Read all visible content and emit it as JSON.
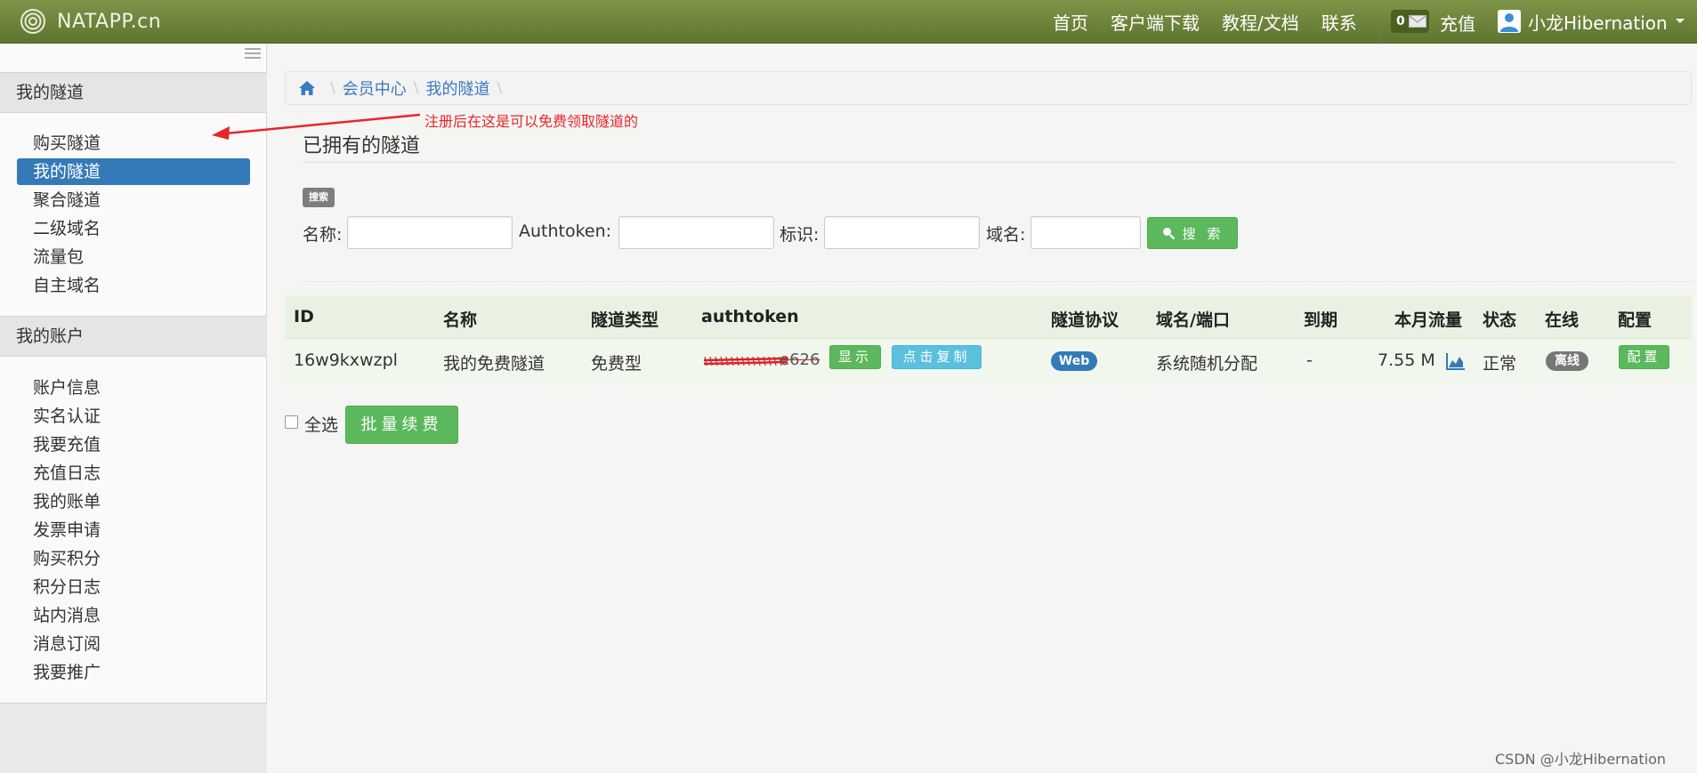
{
  "navbar": {
    "brand": "NATAPP.cn",
    "links": [
      "首页",
      "客户端下载",
      "教程/文档",
      "联系"
    ],
    "message_count": "0",
    "recharge": "充值",
    "user_name": "小龙Hibernation"
  },
  "sidebar": {
    "section1_title": "我的隧道",
    "section1_items": [
      "购买隧道",
      "我的隧道",
      "聚合隧道",
      "二级域名",
      "流量包",
      "自主域名"
    ],
    "section2_title": "我的账户",
    "section2_items": [
      "账户信息",
      "实名认证",
      "我要充值",
      "充值日志",
      "我的账单",
      "发票申请",
      "购买积分",
      "积分日志",
      "站内消息",
      "消息订阅",
      "我要推广"
    ]
  },
  "breadcrumb": [
    "会员中心",
    "我的隧道"
  ],
  "annotation": "注册后在这是可以免费领取隧道的",
  "page_title": "已拥有的隧道",
  "search": {
    "tag": "搜索",
    "name_label": "名称:",
    "authtoken_label": "Authtoken:",
    "tag_label": "标识:",
    "domain_label": "域名:",
    "button": "搜 索"
  },
  "table": {
    "headers": [
      "ID",
      "名称",
      "隧道类型",
      "authtoken",
      "隧道协议",
      "域名/端口",
      "到期",
      "本月流量",
      "状态",
      "在线",
      "配置"
    ],
    "rows": [
      {
        "id": "16w9kxwzpl",
        "name": "我的免费隧道",
        "type": "免费型",
        "authtoken_suffix": "e626",
        "show_button": "显示",
        "copy_button": "点击复制",
        "protocol": "Web",
        "domain": "系统随机分配",
        "expire": "-",
        "traffic": "7.55 M",
        "status": "正常",
        "online": "离线",
        "config_button": "配置"
      }
    ]
  },
  "select_all": "全选",
  "batch_renew": "批量续费",
  "watermark": "CSDN @小龙Hibernation",
  "colors": {
    "navbar": "#6b8239",
    "primary": "#347ab8",
    "success": "#5cb85c",
    "info": "#5bc0de",
    "annotation": "#e8262b"
  }
}
